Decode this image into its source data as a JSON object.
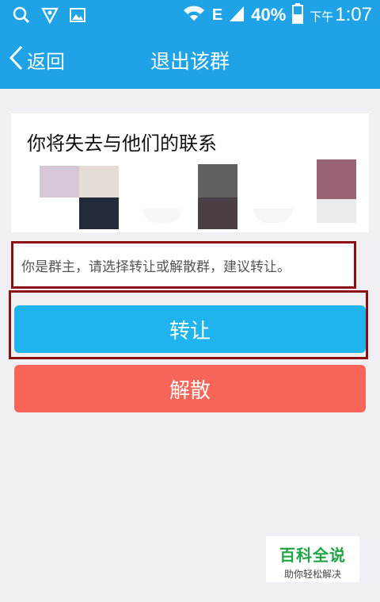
{
  "status_bar": {
    "battery_percent": "40%",
    "time_prefix": "下午",
    "time": "1:07",
    "network_letter": "E",
    "icons": [
      "search-icon",
      "heart-shield-icon",
      "image-icon",
      "wifi-icon",
      "signal-icon",
      "battery-icon"
    ]
  },
  "nav": {
    "back_label": "返回",
    "title": "退出该群"
  },
  "card": {
    "title": "你将失去与他们的联系"
  },
  "notice": "你是群主，请选择转让或解散群，建议转让。",
  "buttons": {
    "transfer": "转让",
    "dissolve": "解散"
  },
  "watermark": {
    "title": "百科全说",
    "subtitle": "助你轻松解决"
  },
  "colors": {
    "header": "#1fa3e6",
    "transfer": "#20b4ef",
    "dissolve": "#f66558",
    "highlight": "#8c0f12"
  }
}
